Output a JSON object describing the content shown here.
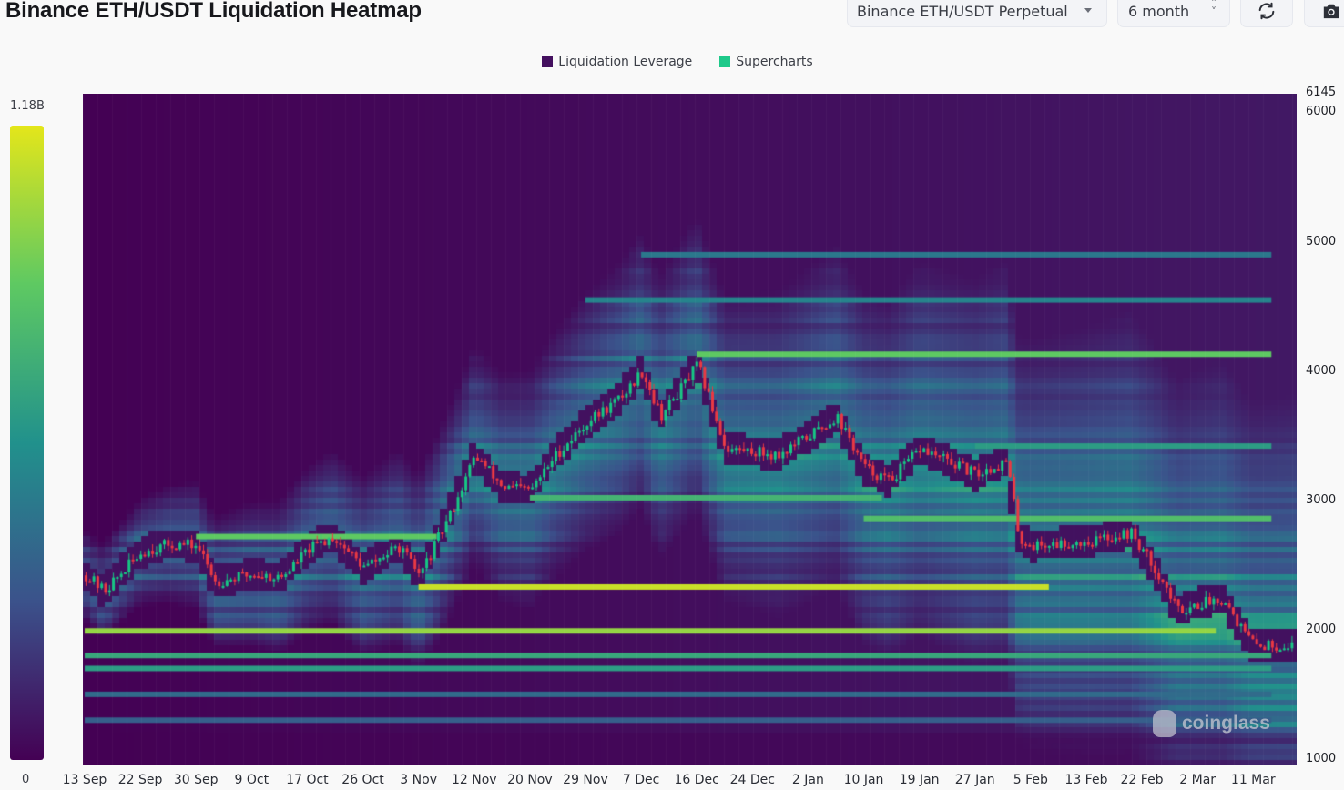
{
  "header": {
    "title": "Binance ETH/USDT Liquidation Heatmap",
    "pair_select": "Binance ETH/USDT Perpetual",
    "range_select": "6 month",
    "refresh_icon": "refresh-icon",
    "camera_icon": "camera-icon"
  },
  "legend": [
    {
      "label": "Liquidation Leverage",
      "color": "#44105f"
    },
    {
      "label": "Supercharts",
      "color": "#1ec98a"
    }
  ],
  "color_scale": {
    "max_label": "1.18B",
    "min_label": "0",
    "stops": [
      "#440154",
      "#3b528b",
      "#21918c",
      "#5ec962",
      "#e4e61a"
    ]
  },
  "watermark": "coinglass",
  "chart_data": {
    "type": "heatmap",
    "title": "Binance ETH/USDT Liquidation Heatmap",
    "xlabel": "",
    "ylabel": "",
    "ylim": [
      950,
      6145
    ],
    "y_ticks": [
      "6145",
      "6000",
      "5000",
      "4000",
      "3000",
      "2000",
      "1000"
    ],
    "y_tick_values": [
      6145,
      6000,
      5000,
      4000,
      3000,
      2000,
      1000
    ],
    "x_ticks": [
      "13 Sep",
      "22 Sep",
      "30 Sep",
      "9 Oct",
      "17 Oct",
      "26 Oct",
      "3 Nov",
      "12 Nov",
      "20 Nov",
      "29 Nov",
      "7 Dec",
      "16 Dec",
      "24 Dec",
      "2 Jan",
      "10 Jan",
      "19 Jan",
      "27 Jan",
      "5 Feb",
      "13 Feb",
      "22 Feb",
      "2 Mar",
      "11 Mar"
    ],
    "colors": {
      "up": "#16c784",
      "down": "#ea3943"
    },
    "price_path": [
      {
        "date": "13 Sep",
        "price": 2420
      },
      {
        "date": "16 Sep",
        "price": 2300
      },
      {
        "date": "22 Sep",
        "price": 2600
      },
      {
        "date": "26 Sep",
        "price": 2660
      },
      {
        "date": "30 Sep",
        "price": 2650
      },
      {
        "date": "3 Oct",
        "price": 2370
      },
      {
        "date": "9 Oct",
        "price": 2430
      },
      {
        "date": "13 Oct",
        "price": 2400
      },
      {
        "date": "17 Oct",
        "price": 2620
      },
      {
        "date": "21 Oct",
        "price": 2720
      },
      {
        "date": "26 Oct",
        "price": 2480
      },
      {
        "date": "31 Oct",
        "price": 2640
      },
      {
        "date": "3 Nov",
        "price": 2420
      },
      {
        "date": "8 Nov",
        "price": 2900
      },
      {
        "date": "12 Nov",
        "price": 3350
      },
      {
        "date": "16 Nov",
        "price": 3100
      },
      {
        "date": "20 Nov",
        "price": 3080
      },
      {
        "date": "24 Nov",
        "price": 3350
      },
      {
        "date": "29 Nov",
        "price": 3600
      },
      {
        "date": "4 Dec",
        "price": 3800
      },
      {
        "date": "7 Dec",
        "price": 4000
      },
      {
        "date": "10 Dec",
        "price": 3650
      },
      {
        "date": "16 Dec",
        "price": 4050
      },
      {
        "date": "20 Dec",
        "price": 3400
      },
      {
        "date": "24 Dec",
        "price": 3380
      },
      {
        "date": "28 Dec",
        "price": 3350
      },
      {
        "date": "2 Jan",
        "price": 3500
      },
      {
        "date": "6 Jan",
        "price": 3650
      },
      {
        "date": "10 Jan",
        "price": 3250
      },
      {
        "date": "14 Jan",
        "price": 3150
      },
      {
        "date": "19 Jan",
        "price": 3400
      },
      {
        "date": "23 Jan",
        "price": 3300
      },
      {
        "date": "27 Jan",
        "price": 3200
      },
      {
        "date": "1 Feb",
        "price": 3300
      },
      {
        "date": "3 Feb",
        "price": 2700
      },
      {
        "date": "5 Feb",
        "price": 2650
      },
      {
        "date": "13 Feb",
        "price": 2680
      },
      {
        "date": "20 Feb",
        "price": 2750
      },
      {
        "date": "24 Feb",
        "price": 2450
      },
      {
        "date": "27 Feb",
        "price": 2150
      },
      {
        "date": "2 Mar",
        "price": 2200
      },
      {
        "date": "6 Mar",
        "price": 2250
      },
      {
        "date": "9 Mar",
        "price": 2000
      },
      {
        "date": "11 Mar",
        "price": 1880
      }
    ],
    "liquidation_bands": [
      {
        "price": 4130,
        "from": "16 Dec",
        "to": "11 Mar",
        "intensity": 0.75
      },
      {
        "price": 2860,
        "from": "10 Jan",
        "to": "11 Mar",
        "intensity": 0.7
      },
      {
        "price": 2330,
        "from": "3 Nov",
        "to": "5 Feb",
        "intensity": 0.95
      },
      {
        "price": 1990,
        "from": "13 Sep",
        "to": "2 Mar",
        "intensity": 0.85
      },
      {
        "price": 2720,
        "from": "30 Sep",
        "to": "3 Nov",
        "intensity": 0.75
      },
      {
        "price": 3020,
        "from": "20 Nov",
        "to": "10 Jan",
        "intensity": 0.65
      },
      {
        "price": 1800,
        "from": "13 Sep",
        "to": "11 Mar",
        "intensity": 0.6
      },
      {
        "price": 1700,
        "from": "13 Sep",
        "to": "11 Mar",
        "intensity": 0.55
      },
      {
        "price": 3420,
        "from": "27 Jan",
        "to": "11 Mar",
        "intensity": 0.55
      },
      {
        "price": 4550,
        "from": "29 Nov",
        "to": "11 Mar",
        "intensity": 0.45
      },
      {
        "price": 4900,
        "from": "7 Dec",
        "to": "11 Mar",
        "intensity": 0.4
      },
      {
        "price": 1500,
        "from": "13 Sep",
        "to": "11 Mar",
        "intensity": 0.35
      },
      {
        "price": 1300,
        "from": "13 Sep",
        "to": "11 Mar",
        "intensity": 0.3
      }
    ]
  }
}
